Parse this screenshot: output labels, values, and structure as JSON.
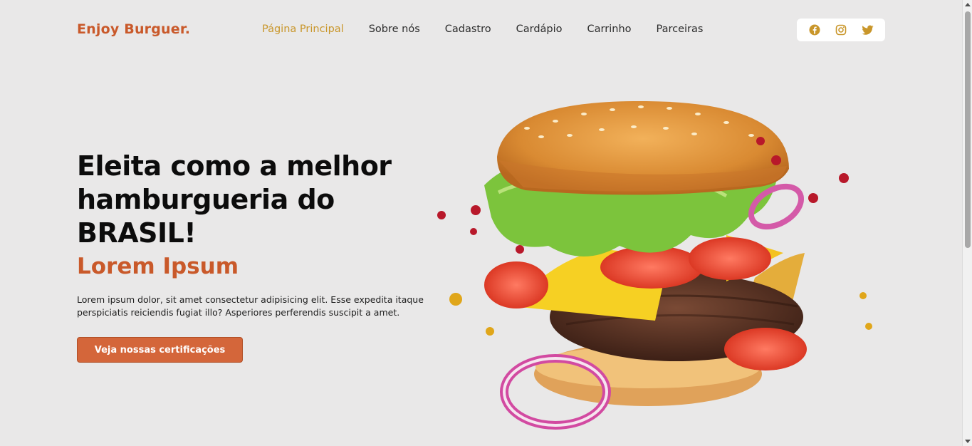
{
  "brand": {
    "name": "Enjoy Burguer."
  },
  "nav": {
    "items": [
      {
        "label": "Página Principal",
        "active": true
      },
      {
        "label": "Sobre nós"
      },
      {
        "label": "Cadastro"
      },
      {
        "label": "Cardápio"
      },
      {
        "label": "Carrinho"
      },
      {
        "label": "Parceiras"
      }
    ]
  },
  "social": {
    "icons": [
      "facebook-icon",
      "instagram-icon",
      "twitter-icon"
    ],
    "color": "#c9962a"
  },
  "hero": {
    "title": "Eleita como a melhor hamburgueria do BRASIL!",
    "subtitle": "Lorem Ipsum",
    "text": "Lorem ipsum dolor, sit amet consectetur adipisicing elit. Esse expedita itaque perspiciatis reiciendis fugiat illo? Asperiores perferendis suscipit a amet.",
    "button_label": "Veja nossas certificações"
  },
  "colors": {
    "brand": "#c9592a",
    "accent": "#c9962a",
    "button": "#d4663a",
    "background": "#e9e8e8"
  }
}
